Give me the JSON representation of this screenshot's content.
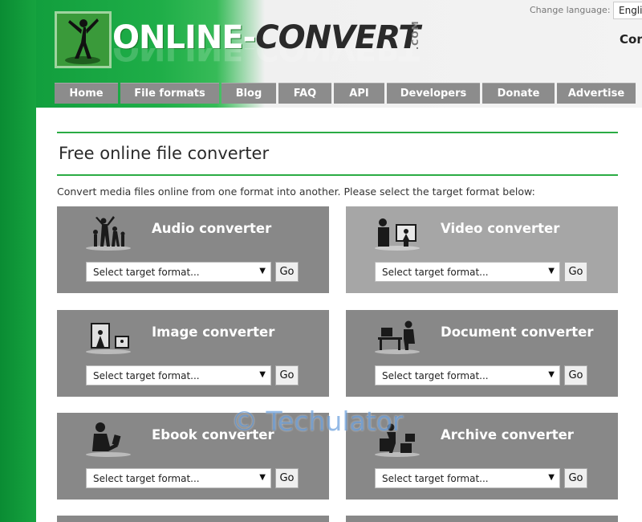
{
  "header": {
    "logo_main": "ONLINE-",
    "logo_second": "CONVERT",
    "logo_com": ".COM",
    "change_language_label": "Change language:",
    "language_value": "English",
    "corner_text": "Con"
  },
  "nav": {
    "items": [
      {
        "label": "Home"
      },
      {
        "label": "File formats"
      },
      {
        "label": "Blog"
      },
      {
        "label": "FAQ"
      },
      {
        "label": "API"
      },
      {
        "label": "Developers"
      },
      {
        "label": "Donate"
      },
      {
        "label": "Advertise"
      }
    ]
  },
  "main": {
    "title": "Free online file converter",
    "intro": "Convert media files online from one format into another. Please select the target format below:",
    "cards": [
      {
        "title": "Audio converter",
        "select_placeholder": "Select target format...",
        "go_label": "Go",
        "icon": "audio-people-icon"
      },
      {
        "title": "Video converter",
        "select_placeholder": "Select target format...",
        "go_label": "Go",
        "icon": "video-icon"
      },
      {
        "title": "Image converter",
        "select_placeholder": "Select target format...",
        "go_label": "Go",
        "icon": "image-icon"
      },
      {
        "title": "Document converter",
        "select_placeholder": "Select target format...",
        "go_label": "Go",
        "icon": "document-desk-icon"
      },
      {
        "title": "Ebook converter",
        "select_placeholder": "Select target format...",
        "go_label": "Go",
        "icon": "ebook-reader-icon"
      },
      {
        "title": "Archive converter",
        "select_placeholder": "Select target format...",
        "go_label": "Go",
        "icon": "archive-box-icon"
      }
    ]
  },
  "watermark": "© Techulator",
  "colors": {
    "brand_green": "#2bac44",
    "nav_gray": "#8c8c8c",
    "card_gray": "#888888",
    "card_light_gray": "#a6a6a6"
  }
}
